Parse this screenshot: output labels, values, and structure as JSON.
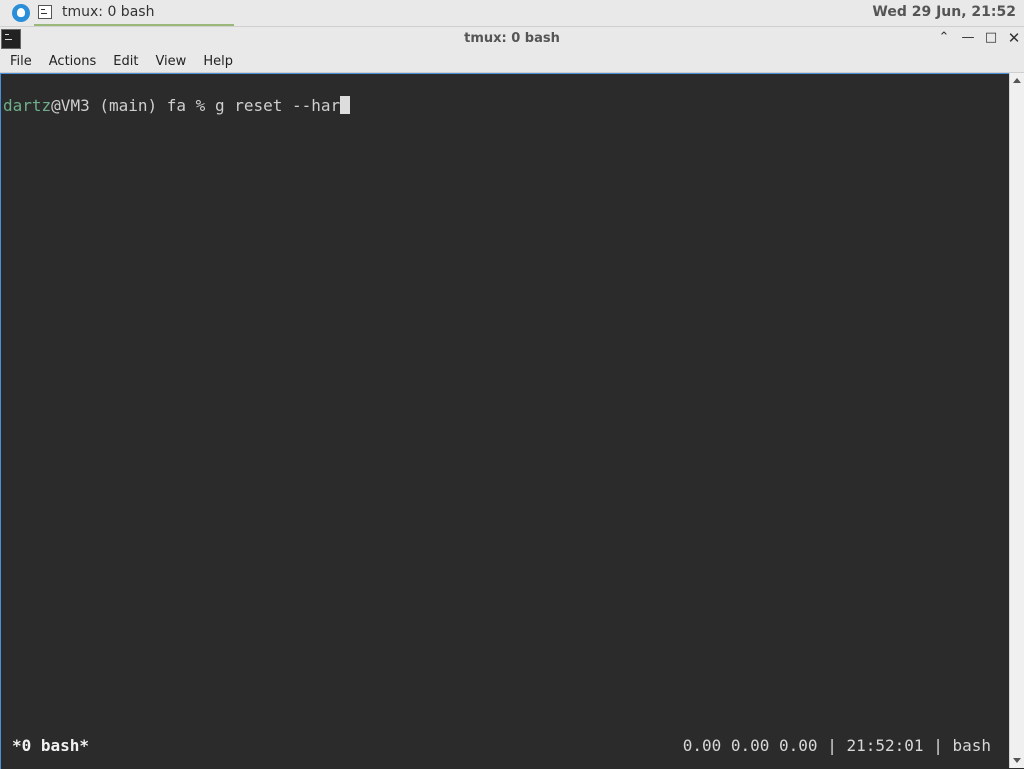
{
  "panel": {
    "task_label": "tmux: 0 bash",
    "clock": "Wed 29 Jun, 21:52"
  },
  "window": {
    "title": "tmux: 0 bash"
  },
  "menu": {
    "items": [
      "File",
      "Actions",
      "Edit",
      "View",
      "Help"
    ]
  },
  "terminal": {
    "prompt_user": "dartz",
    "prompt_rest": "@VM3 (main) fa % ",
    "command": "g reset --har"
  },
  "tmux_status": {
    "left": "*0 bash*",
    "load": "0.00 0.00 0.00",
    "time": "21:52:01",
    "session": "bash",
    "separator": "|"
  },
  "icons": {
    "panel_menu": "whisker-menu-icon",
    "task": "terminal-icon",
    "app": "terminal-icon",
    "window_up": "chevron-up-icon",
    "window_min": "minimize-icon",
    "window_max": "maximize-icon",
    "window_close": "close-icon"
  }
}
